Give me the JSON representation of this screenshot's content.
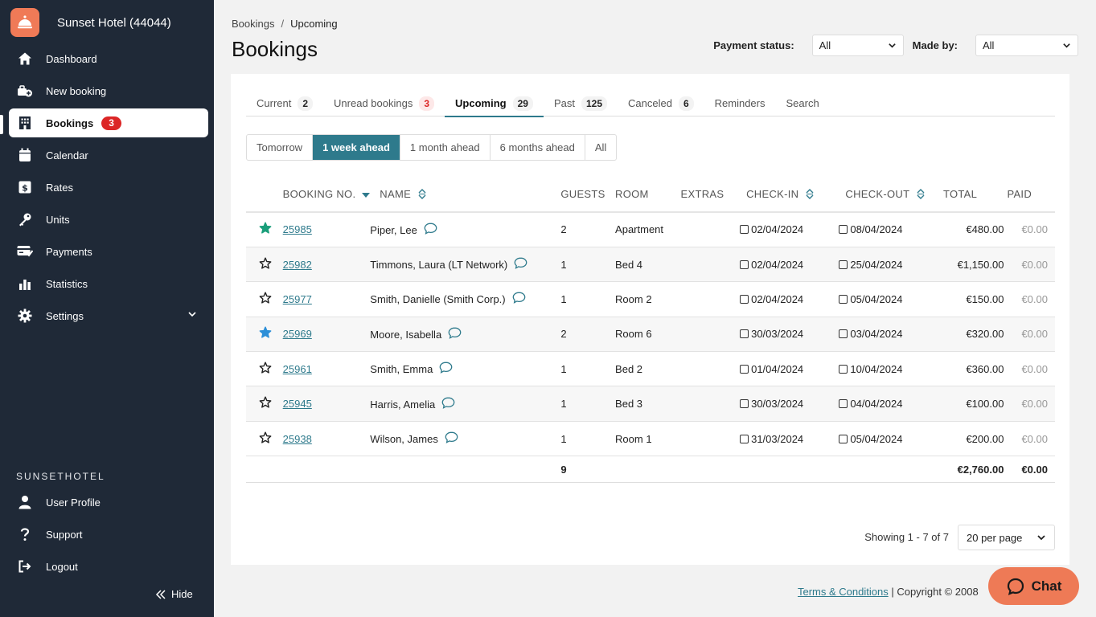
{
  "app": {
    "hotel_name": "Sunset Hotel (44044)"
  },
  "sidebar": {
    "items": [
      {
        "label": "Dashboard",
        "icon": "home-icon"
      },
      {
        "label": "New booking",
        "icon": "new-booking-icon"
      },
      {
        "label": "Bookings",
        "icon": "building-icon",
        "badge": "3",
        "active": true
      },
      {
        "label": "Calendar",
        "icon": "calendar-icon"
      },
      {
        "label": "Rates",
        "icon": "dollar-icon"
      },
      {
        "label": "Units",
        "icon": "key-icon"
      },
      {
        "label": "Payments",
        "icon": "payment-card-icon"
      },
      {
        "label": "Statistics",
        "icon": "bar-chart-icon"
      },
      {
        "label": "Settings",
        "icon": "gear-icon"
      }
    ],
    "section_label": "SUNSETHOTEL",
    "account_items": [
      {
        "label": "User Profile",
        "icon": "user-icon"
      },
      {
        "label": "Support",
        "icon": "question-icon"
      },
      {
        "label": "Logout",
        "icon": "logout-icon"
      }
    ],
    "hide_label": "Hide"
  },
  "breadcrumb": {
    "parent": "Bookings",
    "separator": "/",
    "current": "Upcoming"
  },
  "page_title": "Bookings",
  "filters": {
    "payment_status_label": "Payment status:",
    "payment_status_value": "All",
    "made_by_label": "Made by:",
    "made_by_value": "All"
  },
  "tabs": [
    {
      "label": "Current",
      "count": "2"
    },
    {
      "label": "Unread bookings",
      "count": "3",
      "highlight": true
    },
    {
      "label": "Upcoming",
      "count": "29",
      "active": true
    },
    {
      "label": "Past",
      "count": "125"
    },
    {
      "label": "Canceled",
      "count": "6"
    },
    {
      "label": "Reminders"
    },
    {
      "label": "Search"
    }
  ],
  "range": [
    "Tomorrow",
    "1 week ahead",
    "1 month ahead",
    "6 months ahead",
    "All"
  ],
  "range_active": "1 week ahead",
  "table": {
    "headers": {
      "booking_no": "BOOKING NO.",
      "name": "NAME",
      "guests": "GUESTS",
      "room": "ROOM",
      "extras": "EXTRAS",
      "check_in": "CHECK-IN",
      "check_out": "CHECK-OUT",
      "total": "TOTAL",
      "paid": "PAID"
    },
    "rows": [
      {
        "star": "green",
        "booking_no": "25985",
        "name": "Piper, Lee",
        "guests": "2",
        "room": "Apartment",
        "check_in": "02/04/2024",
        "check_out": "08/04/2024",
        "total": "€480.00",
        "paid": "€0.00"
      },
      {
        "star": "none",
        "booking_no": "25982",
        "name": "Timmons, Laura (LT Network)",
        "guests": "1",
        "room": "Bed 4",
        "check_in": "02/04/2024",
        "check_out": "25/04/2024",
        "total": "€1,150.00",
        "paid": "€0.00"
      },
      {
        "star": "none",
        "booking_no": "25977",
        "name": "Smith, Danielle (Smith Corp.)",
        "guests": "1",
        "room": "Room 2",
        "check_in": "02/04/2024",
        "check_out": "05/04/2024",
        "total": "€150.00",
        "paid": "€0.00"
      },
      {
        "star": "blue",
        "booking_no": "25969",
        "name": "Moore, Isabella",
        "guests": "2",
        "room": "Room 6",
        "check_in": "30/03/2024",
        "check_out": "03/04/2024",
        "total": "€320.00",
        "paid": "€0.00"
      },
      {
        "star": "none",
        "booking_no": "25961",
        "name": "Smith, Emma",
        "guests": "1",
        "room": "Bed 2",
        "check_in": "01/04/2024",
        "check_out": "10/04/2024",
        "total": "€360.00",
        "paid": "€0.00"
      },
      {
        "star": "none",
        "booking_no": "25945",
        "name": "Harris, Amelia",
        "guests": "1",
        "room": "Bed 3",
        "check_in": "30/03/2024",
        "check_out": "04/04/2024",
        "total": "€100.00",
        "paid": "€0.00"
      },
      {
        "star": "none",
        "booking_no": "25938",
        "name": "Wilson, James",
        "guests": "1",
        "room": "Room 1",
        "check_in": "31/03/2024",
        "check_out": "05/04/2024",
        "total": "€200.00",
        "paid": "€0.00"
      }
    ],
    "totals": {
      "guests": "9",
      "total": "€2,760.00",
      "paid": "€0.00"
    }
  },
  "pagination": {
    "showing": "Showing 1 - 7 of 7",
    "per_page": "20 per page"
  },
  "footer": {
    "terms": "Terms & Conditions",
    "copyright": "| Copyright © 2008"
  },
  "chat": {
    "label": "Chat"
  },
  "colors": {
    "accent": "#2e7a8c",
    "sidebar": "#1f2937",
    "brand": "#f07a57",
    "badge": "#dc2626",
    "star_green": "#1a9e7a",
    "star_blue": "#2d8fd8",
    "chat": "#ee7a56"
  }
}
